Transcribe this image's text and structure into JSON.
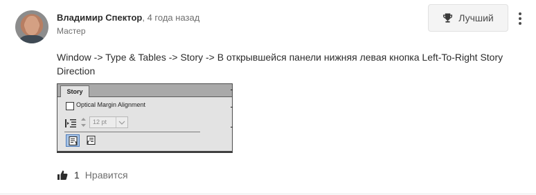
{
  "comment": {
    "author": "Владимир Спектор",
    "separator": ",",
    "time": "4 года назад",
    "rank": "Мастер",
    "body": "Window -> Type & Tables -> Story -> В открывшейся панели нижняя левая кнопка Left-To-Right Story Direction",
    "best_label": "Лучший",
    "like_count": "1",
    "like_label": "Нравится"
  },
  "story_panel": {
    "tab_label": "Story",
    "optical_margin_label": "Optical Margin Alignment",
    "optical_margin_checked": false,
    "size_value": "12 pt",
    "active_direction": "left-to-right"
  },
  "colors": {
    "text": "#2c2c2c",
    "muted": "#6e6e6e",
    "button_bg": "#f4f4f4",
    "active_direction": "#a8c4e6"
  }
}
